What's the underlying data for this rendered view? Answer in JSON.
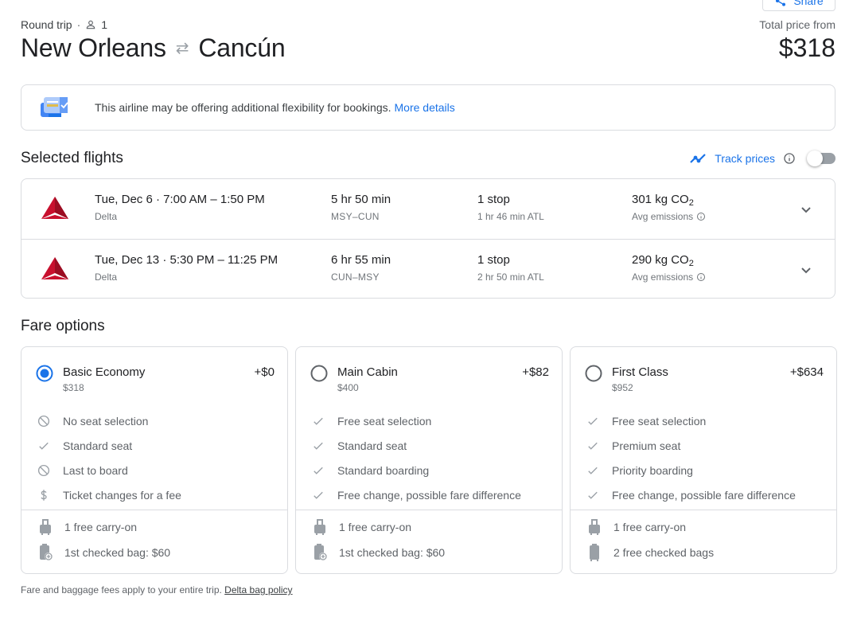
{
  "header": {
    "share_label": "Share",
    "trip_type": "Round trip",
    "passengers": "1",
    "origin": "New Orleans",
    "destination": "Cancún",
    "total_label": "Total price from",
    "total_price": "$318"
  },
  "banner": {
    "text": "This airline may be offering additional flexibility for bookings.",
    "link": "More details"
  },
  "selected_flights": {
    "title": "Selected flights",
    "track_label": "Track prices",
    "track_enabled": false,
    "flights": [
      {
        "date_time": "Tue, Dec 6 · 7:00 AM – 1:50 PM",
        "airline": "Delta",
        "duration": "5 hr 50 min",
        "route": "MSY–CUN",
        "stops": "1 stop",
        "layover": "1 hr 46 min ATL",
        "co2_value": "301 kg CO",
        "co2_sub": "2",
        "emissions_label": "Avg emissions"
      },
      {
        "date_time": "Tue, Dec 13 · 5:30 PM – 11:25 PM",
        "airline": "Delta",
        "duration": "6 hr 55 min",
        "route": "CUN–MSY",
        "stops": "1 stop",
        "layover": "2 hr 50 min ATL",
        "co2_value": "290 kg CO",
        "co2_sub": "2",
        "emissions_label": "Avg emissions"
      }
    ]
  },
  "fare_options": {
    "title": "Fare options",
    "selected_index": 0,
    "cards": [
      {
        "name": "Basic Economy",
        "base_price": "$318",
        "diff": "+$0",
        "features": [
          {
            "icon": "block-icon",
            "text": "No seat selection"
          },
          {
            "icon": "check-icon",
            "text": "Standard seat"
          },
          {
            "icon": "block-icon",
            "text": "Last to board"
          },
          {
            "icon": "dollar-icon",
            "text": "Ticket changes for a fee"
          }
        ],
        "bags": [
          {
            "icon": "carry-on-icon",
            "text": "1 free carry-on"
          },
          {
            "icon": "checked-bag-fee-icon",
            "text": "1st checked bag: $60"
          }
        ]
      },
      {
        "name": "Main Cabin",
        "base_price": "$400",
        "diff": "+$82",
        "features": [
          {
            "icon": "check-icon",
            "text": "Free seat selection"
          },
          {
            "icon": "check-icon",
            "text": "Standard seat"
          },
          {
            "icon": "check-icon",
            "text": "Standard boarding"
          },
          {
            "icon": "check-icon",
            "text": "Free change, possible fare difference"
          }
        ],
        "bags": [
          {
            "icon": "carry-on-icon",
            "text": "1 free carry-on"
          },
          {
            "icon": "checked-bag-fee-icon",
            "text": "1st checked bag: $60"
          }
        ]
      },
      {
        "name": "First Class",
        "base_price": "$952",
        "diff": "+$634",
        "features": [
          {
            "icon": "check-icon",
            "text": "Free seat selection"
          },
          {
            "icon": "check-icon",
            "text": "Premium seat"
          },
          {
            "icon": "check-icon",
            "text": "Priority boarding"
          },
          {
            "icon": "check-icon",
            "text": "Free change, possible fare difference"
          }
        ],
        "bags": [
          {
            "icon": "carry-on-icon",
            "text": "1 free carry-on"
          },
          {
            "icon": "checked-bag-icon",
            "text": "2 free checked bags"
          }
        ]
      }
    ]
  },
  "footer": {
    "text": "Fare and baggage fees apply to your entire trip.",
    "link": "Delta bag policy"
  },
  "colors": {
    "accent": "#1a73e8",
    "delta_red": "#c8102e",
    "text_primary": "#202124",
    "text_secondary": "#70757a",
    "border": "#dadce0"
  }
}
